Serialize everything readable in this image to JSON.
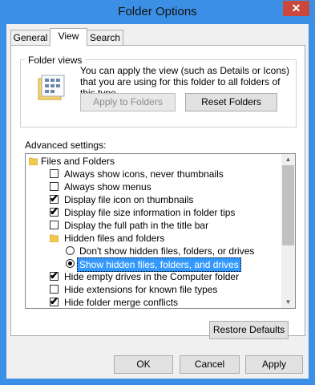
{
  "window": {
    "title": "Folder Options",
    "close_glyph": "✕"
  },
  "tabs": [
    {
      "label": "General"
    },
    {
      "label": "View"
    },
    {
      "label": "Search"
    }
  ],
  "folder_views": {
    "title": "Folder views",
    "description": "You can apply the view (such as Details or Icons) that you are using for this folder to all folders of this type.",
    "apply_label": "Apply to Folders",
    "reset_label": "Reset Folders"
  },
  "advanced": {
    "label": "Advanced settings:",
    "items": [
      {
        "type": "folder",
        "label": "Files and Folders"
      },
      {
        "type": "checkbox",
        "checked": false,
        "label": "Always show icons, never thumbnails"
      },
      {
        "type": "checkbox",
        "checked": false,
        "label": "Always show menus"
      },
      {
        "type": "checkbox",
        "checked": true,
        "label": "Display file icon on thumbnails"
      },
      {
        "type": "checkbox",
        "checked": true,
        "label": "Display file size information in folder tips"
      },
      {
        "type": "checkbox",
        "checked": false,
        "label": "Display the full path in the title bar"
      },
      {
        "type": "folder",
        "label": "Hidden files and folders"
      },
      {
        "type": "radio",
        "checked": false,
        "label": "Don't show hidden files, folders, or drives"
      },
      {
        "type": "radio",
        "checked": true,
        "label": "Show hidden files, folders, and drives"
      },
      {
        "type": "checkbox",
        "checked": true,
        "label": "Hide empty drives in the Computer folder"
      },
      {
        "type": "checkbox",
        "checked": false,
        "label": "Hide extensions for known file types"
      },
      {
        "type": "checkbox",
        "checked": true,
        "label": "Hide folder merge conflicts"
      }
    ]
  },
  "restore_label": "Restore Defaults",
  "footer": {
    "ok": "OK",
    "cancel": "Cancel",
    "apply": "Apply"
  }
}
